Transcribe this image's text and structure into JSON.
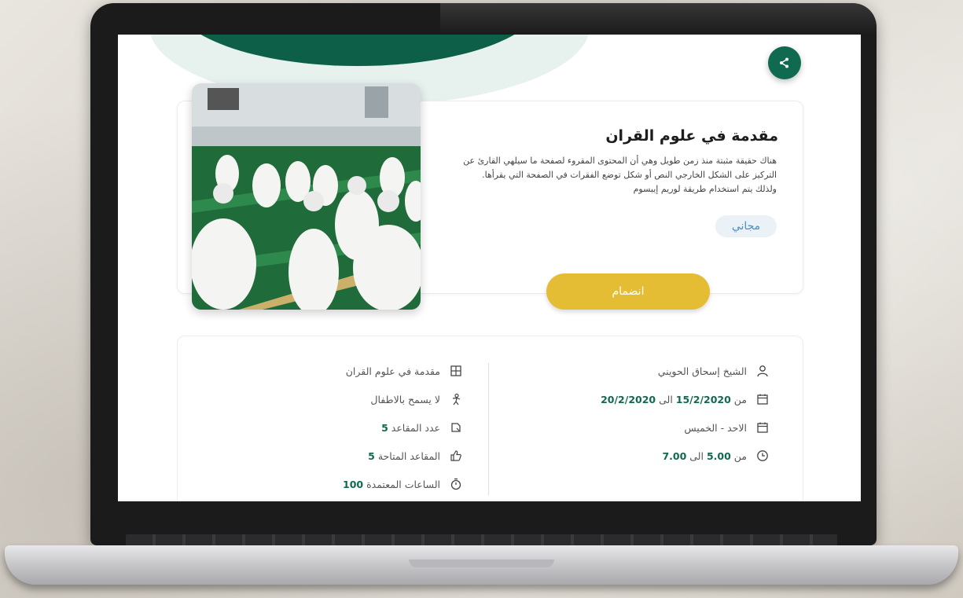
{
  "course": {
    "title": "مقدمة في علوم القران",
    "description": "هناك حقيقة مثبتة منذ زمن طويل وهي أن المحتوى المقروء لصفحة ما سيلهي القارئ عن التركيز على الشكل الخارجي النص أو شكل توضع الفقرات في الصفحة التي يقرأها. ولذلك يتم استخدام طريقة لوريم إيبسوم",
    "price_label": "مجاني",
    "join_label": "انضمام"
  },
  "details": {
    "right": {
      "instructor": "الشيخ إسحاق الحويني",
      "date_prefix": "من",
      "date_from": "15/2/2020",
      "date_sep": "الى",
      "date_to": "20/2/2020",
      "days": "الاحد - الخميس",
      "time_prefix": "من",
      "time_from": "5.00",
      "time_sep": "الى",
      "time_to": "7.00"
    },
    "left": {
      "course_name": "مقدمة في علوم القران",
      "children_note": "لا يسمح بالاطفال",
      "seats_label": "عدد المقاعد",
      "seats_value": "5",
      "available_label": "المقاعد المتاحة",
      "available_value": "5",
      "hours_label": "الساعات المعتمدة",
      "hours_value": "100"
    }
  },
  "icons": {
    "share": "share-icon",
    "user": "user-icon",
    "calendar": "calendar-icon",
    "clock": "clock-icon",
    "book": "book-icon",
    "no-children": "child-icon",
    "seat": "seat-icon",
    "thumbs-up": "thumbs-up-icon",
    "stopwatch": "stopwatch-icon"
  },
  "colors": {
    "primary_green": "#0f6a50",
    "join_yellow": "#e5bd34",
    "badge_blue": "#4a8fc1"
  }
}
